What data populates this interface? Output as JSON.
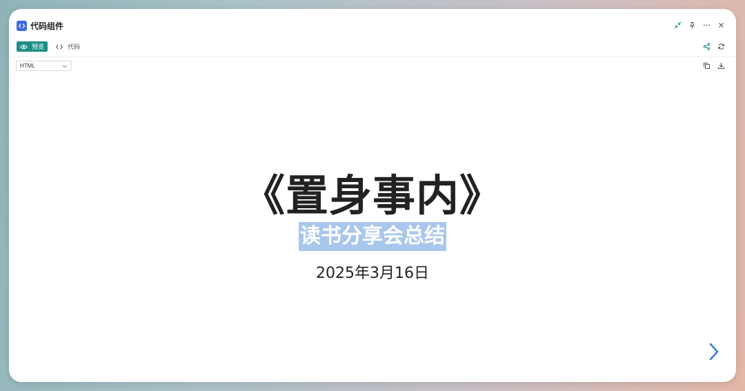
{
  "window": {
    "title": "代码组件",
    "icons": [
      "code-icon",
      "collapse-icon",
      "pin-icon",
      "more-icon",
      "close-icon"
    ]
  },
  "toolbar": {
    "preview_label": "预览",
    "code_label": "代码",
    "icons": [
      "eye-icon",
      "code-icon",
      "share-icon",
      "refresh-icon"
    ]
  },
  "editor": {
    "language": "HTML",
    "icons": [
      "copy-icon",
      "download-icon"
    ]
  },
  "slide": {
    "title": "《置身事内》",
    "subtitle": "读书分享会总结",
    "date": "2025年3月16日"
  },
  "colors": {
    "accent": "#1b8f86",
    "app_icon": "#3c6ae0",
    "selection": "#a9c7ec",
    "next_arrow": "#3a7fd5"
  }
}
